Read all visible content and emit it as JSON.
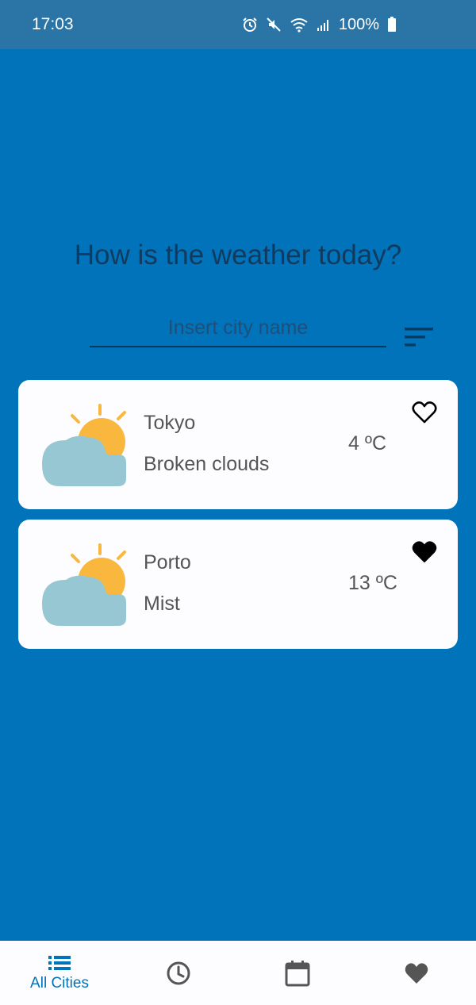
{
  "status_bar": {
    "time": "17:03",
    "battery": "100%",
    "icons": [
      "alarm-icon",
      "mute-icon",
      "wifi-icon",
      "signal-icon",
      "battery-icon"
    ]
  },
  "headline": "How is the weather today?",
  "search": {
    "placeholder": "Insert city name",
    "value": ""
  },
  "filter_icon": "sort-icon",
  "cities": [
    {
      "name": "Tokyo",
      "description": "Broken clouds",
      "temperature": "4 ºC",
      "favorite": false,
      "icon": "partly-cloudy-icon"
    },
    {
      "name": "Porto",
      "description": "Mist",
      "temperature": "13 ºC",
      "favorite": true,
      "icon": "partly-cloudy-icon"
    }
  ],
  "bottom_nav": {
    "items": [
      {
        "label": "All Cities",
        "icon": "list-icon",
        "active": true
      },
      {
        "label": "",
        "icon": "clock-icon",
        "active": false
      },
      {
        "label": "",
        "icon": "calendar-icon",
        "active": false
      },
      {
        "label": "",
        "icon": "heart-icon",
        "active": false
      }
    ]
  },
  "colors": {
    "background": "#0073BA",
    "status_bar": "#2A74A6",
    "card": "#FDFCFF",
    "sun": "#F9B73E",
    "cloud": "#97C7D3",
    "active_nav": "#0073BA"
  }
}
